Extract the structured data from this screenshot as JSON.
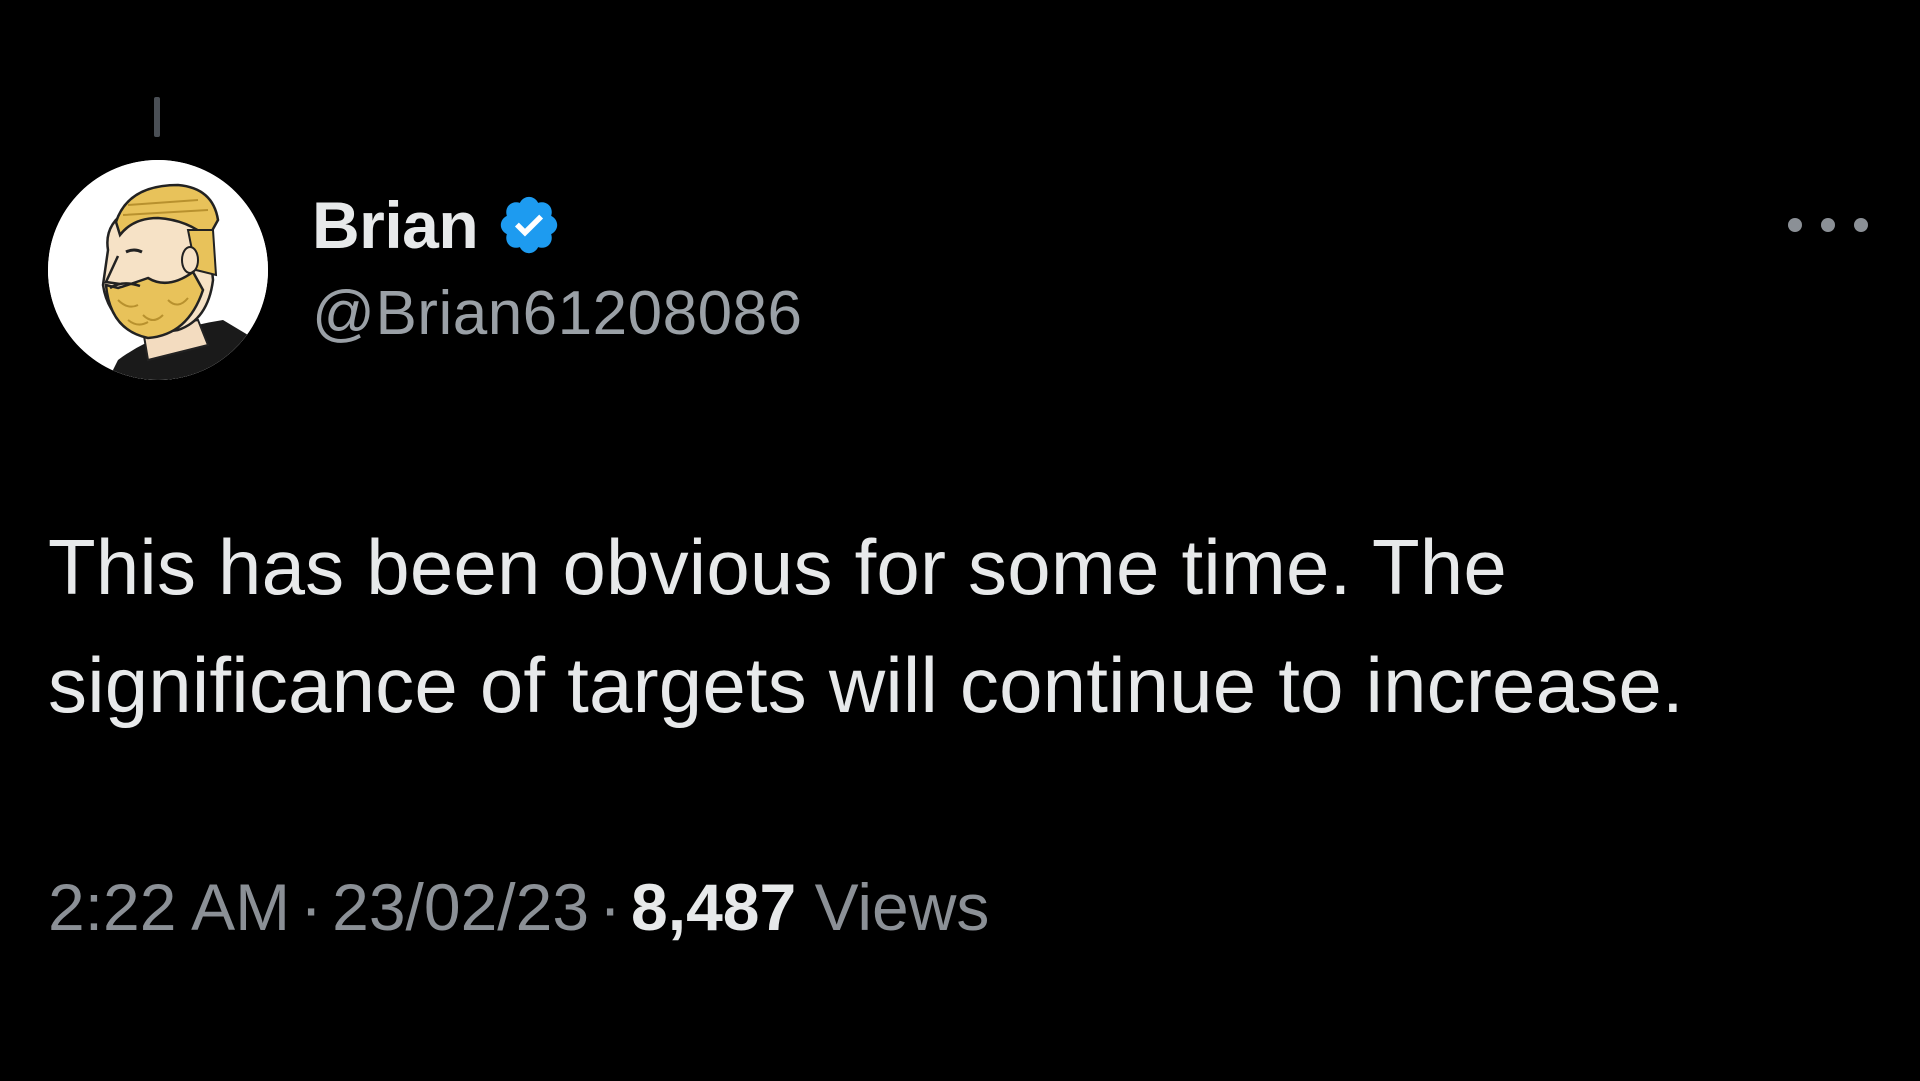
{
  "tweet": {
    "author": {
      "display_name": "Brian",
      "handle": "@Brian61208086",
      "verified": true,
      "verified_color": "#1d9bf0",
      "avatar_icon": "bearded-man-avatar"
    },
    "more_icon": "more-horizontal-icon",
    "text": "This has been obvious for some time. The\nsignificance of targets will continue to increase.",
    "time": "2:22 AM",
    "separator": "·",
    "date": "23/02/23",
    "views_count": "8,487",
    "views_label": "Views"
  },
  "colors": {
    "background": "#000000",
    "primary_text": "#e7e9ea",
    "secondary_text": "#8b9096"
  }
}
